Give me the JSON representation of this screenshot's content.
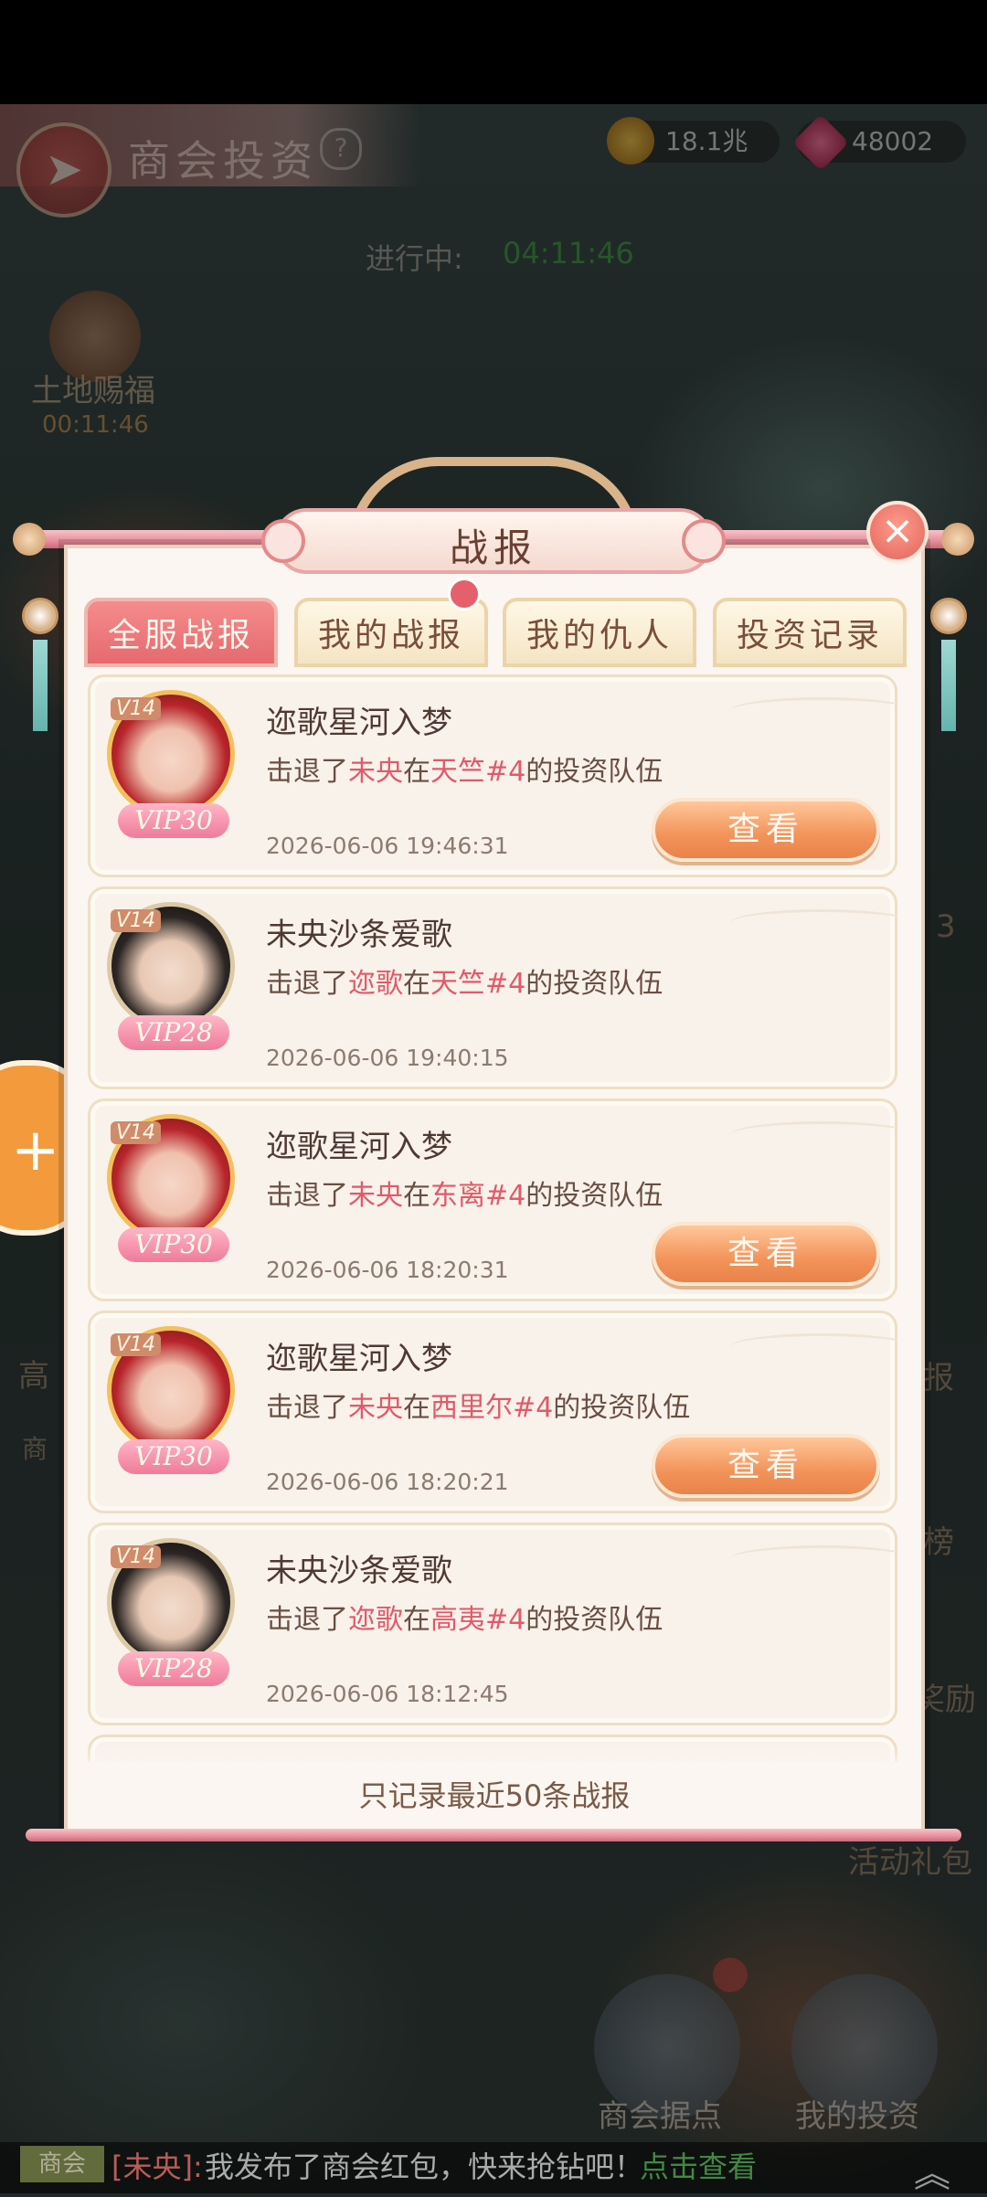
{
  "header": {
    "title": "商会投资",
    "gold": "18.1兆",
    "gems": "48002"
  },
  "status": {
    "label": "进行中:",
    "timer": "04:11:46"
  },
  "blessing": {
    "label": "土地赐福",
    "timer": "00:11:46"
  },
  "modal": {
    "title": "战报",
    "close_icon": "×",
    "tabs": [
      {
        "label": "全服战报",
        "active": true
      },
      {
        "label": "我的战报",
        "active": false
      },
      {
        "label": "我的仇人",
        "active": false
      },
      {
        "label": "投资记录",
        "active": false
      }
    ],
    "footer_note": "只记录最近50条战报"
  },
  "reports": [
    {
      "name": "迩歌星河入梦",
      "prefix": "击退了",
      "target": "未央",
      "mid": "在",
      "location": "天竺#4",
      "suffix": "的投资队伍",
      "time": "2026-06-06 19:46:31",
      "level": "V14",
      "vip": "VIP30",
      "view": "查看"
    },
    {
      "name": "未央沙条爱歌",
      "prefix": "击退了",
      "target": "迩歌",
      "mid": "在",
      "location": "天竺#4",
      "suffix": "的投资队伍",
      "time": "2026-06-06 19:40:15",
      "level": "V14",
      "vip": "VIP28"
    },
    {
      "name": "迩歌星河入梦",
      "prefix": "击退了",
      "target": "未央",
      "mid": "在",
      "location": "东离#4",
      "suffix": "的投资队伍",
      "time": "2026-06-06 18:20:31",
      "level": "V14",
      "vip": "VIP30",
      "view": "查看"
    },
    {
      "name": "迩歌星河入梦",
      "prefix": "击退了",
      "target": "未央",
      "mid": "在",
      "location": "西里尔#4",
      "suffix": "的投资队伍",
      "time": "2026-06-06 18:20:21",
      "level": "V14",
      "vip": "VIP30",
      "view": "查看"
    },
    {
      "name": "未央沙条爱歌",
      "prefix": "击退了",
      "target": "迩歌",
      "mid": "在",
      "location": "高夷#4",
      "suffix": "的投资队伍",
      "time": "2026-06-06 18:12:45",
      "level": "V14",
      "vip": "VIP28"
    }
  ],
  "background": {
    "left_tag_1": "高",
    "left_tag_2": "商",
    "right_labels": [
      "3",
      "报",
      "榜",
      "奖励",
      "活动礼包"
    ],
    "bottom_buttons": [
      "商会据点",
      "我的投资"
    ]
  },
  "chat": {
    "tag": "商会",
    "sender": "[未央]:",
    "message": "我发布了商会红包，快来抢钻吧！",
    "link": "点击查看"
  },
  "colors": {
    "accent_red": "#e56a6e",
    "highlight": "#e05a6a",
    "button_orange": "#f29359"
  }
}
